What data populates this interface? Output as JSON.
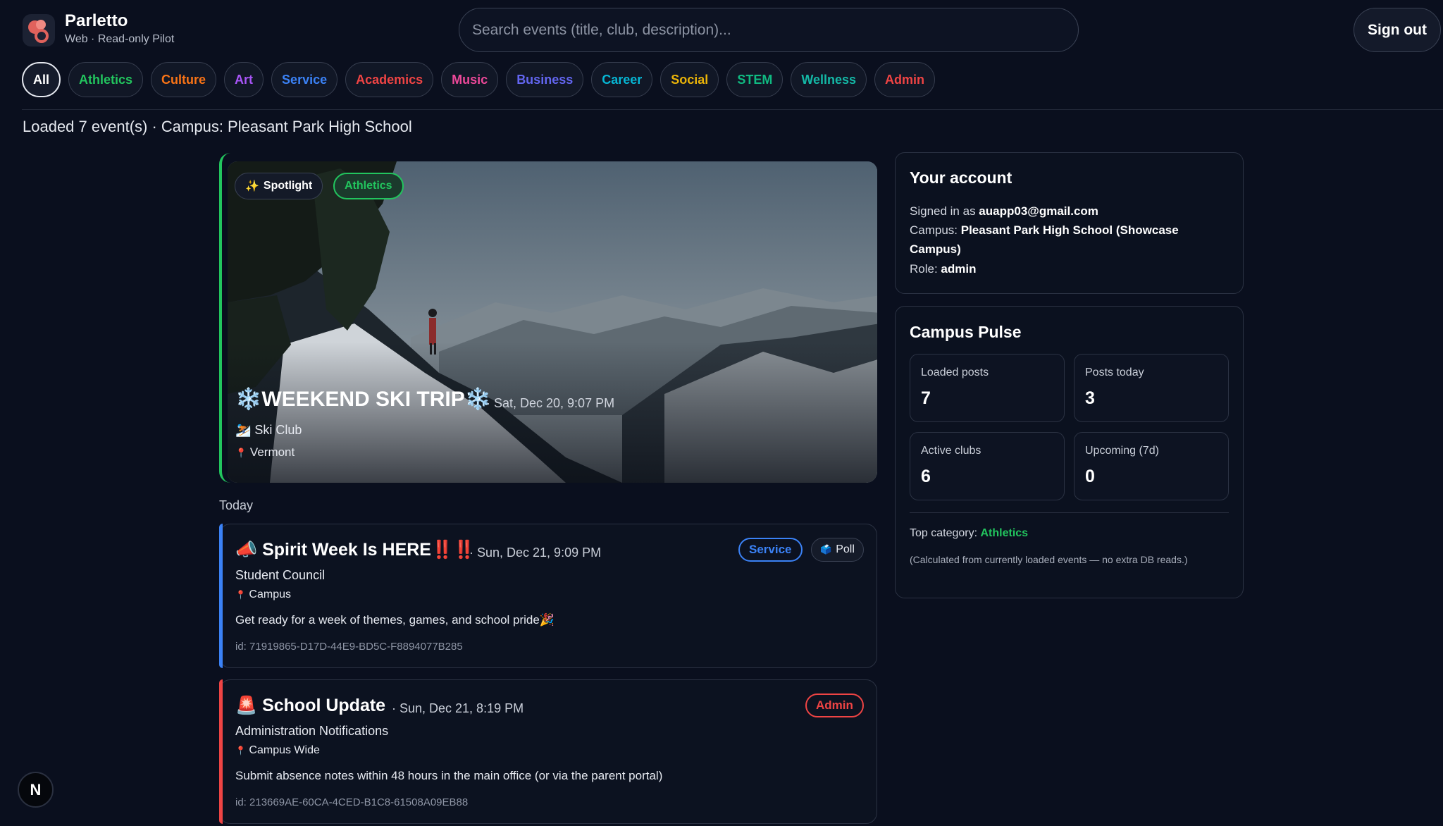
{
  "app": {
    "name": "Parletto",
    "subtitle": "Web · Read-only Pilot"
  },
  "search": {
    "placeholder": "Search events (title, club, description)..."
  },
  "header": {
    "signout_label": "Sign out"
  },
  "categories": [
    {
      "label": "All",
      "color": "#ffffff",
      "active": true
    },
    {
      "label": "Athletics",
      "color": "#22c55e"
    },
    {
      "label": "Culture",
      "color": "#f97316"
    },
    {
      "label": "Art",
      "color": "#a855f7"
    },
    {
      "label": "Service",
      "color": "#3b82f6"
    },
    {
      "label": "Academics",
      "color": "#ef4444"
    },
    {
      "label": "Music",
      "color": "#ec4899"
    },
    {
      "label": "Business",
      "color": "#6366f1"
    },
    {
      "label": "Career",
      "color": "#06b6d4"
    },
    {
      "label": "Social",
      "color": "#eab308"
    },
    {
      "label": "STEM",
      "color": "#10b981"
    },
    {
      "label": "Wellness",
      "color": "#14b8a6"
    },
    {
      "label": "Admin",
      "color": "#ef4444"
    }
  ],
  "status": {
    "text": "Loaded 7 event(s) · Campus: Pleasant Park High School"
  },
  "spotlight": {
    "badge": "Spotlight",
    "badge_icon": "sparkles-icon",
    "category": "Athletics",
    "title": "❄️WEEKEND SKI TRIP❄️",
    "date": "· Sat, Dec 20, 9:07 PM",
    "club": "⛷️ Ski Club",
    "location": "Vermont",
    "accent": "#22c55e"
  },
  "section_today": "Today",
  "events": [
    {
      "title": "📣 Spirit Week Is HERE‼️‼️",
      "date": "· Sun, Dec 21, 9:09 PM",
      "club": "Student Council",
      "location": "Campus",
      "description": "Get ready for a week of themes, games, and school pride🎉",
      "id": "id: 71919865-D17D-44E9-BD5C-F8894077B285",
      "tag": "Service",
      "tag_color": "#3b82f6",
      "poll_label": "Poll"
    },
    {
      "title": "🚨 School Update",
      "date": "· Sun, Dec 21, 8:19 PM",
      "club": "Administration Notifications",
      "location": "Campus Wide",
      "description": "Submit absence notes within 48 hours in the main office (or via the parent portal)",
      "id": "id: 213669AE-60CA-4CED-B1C8-61508A09EB88",
      "tag": "Admin",
      "tag_color": "#ef4444"
    }
  ],
  "account": {
    "heading": "Your account",
    "signed_in_prefix": "Signed in as ",
    "email": "auapp03@gmail.com",
    "campus_prefix": "Campus: ",
    "campus": "Pleasant Park High School (Showcase Campus)",
    "role_prefix": "Role: ",
    "role": "admin"
  },
  "pulse": {
    "heading": "Campus Pulse",
    "stats": [
      {
        "label": "Loaded posts",
        "value": "7"
      },
      {
        "label": "Posts today",
        "value": "3"
      },
      {
        "label": "Active clubs",
        "value": "6"
      },
      {
        "label": "Upcoming (7d)",
        "value": "0"
      }
    ],
    "top_category_prefix": "Top category: ",
    "top_category": "Athletics",
    "note": "(Calculated from currently loaded events — no extra DB reads.)"
  },
  "dev_badge": "N"
}
